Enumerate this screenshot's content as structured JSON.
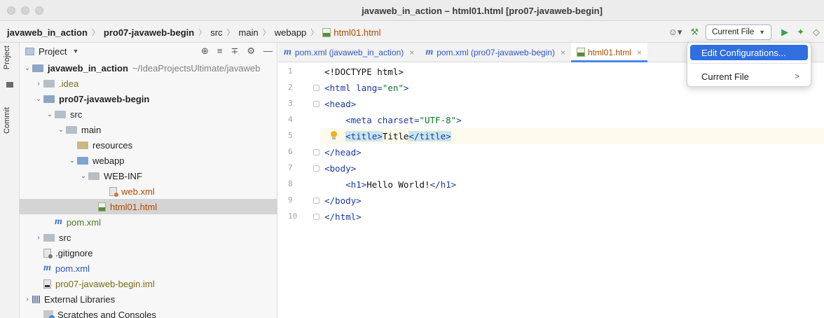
{
  "window": {
    "title": "javaweb_in_action – html01.html [pro07-javaweb-begin]"
  },
  "breadcrumb": [
    "javaweb_in_action",
    "pro07-javaweb-begin",
    "src",
    "main",
    "webapp",
    "html01.html"
  ],
  "toolbar": {
    "user_icon": "☺▾",
    "build_icon": "⚒",
    "run_config": "Current File",
    "run_icon": "▶",
    "debug_icon": "✦",
    "coverage_icon": "◇"
  },
  "stripe": {
    "project_tab": "Project",
    "commit_tab": "Commit"
  },
  "project_panel": {
    "title": "Project",
    "tools": [
      "⊕",
      "≡",
      "∓",
      "⚙",
      "—"
    ],
    "tree": [
      {
        "label": "javaweb_in_action",
        "path": "~/IdeaProjectsUltimate/javaweb"
      },
      {
        "label": ".idea"
      },
      {
        "label": "pro07-javaweb-begin"
      },
      {
        "label": "src"
      },
      {
        "label": "main"
      },
      {
        "label": "resources"
      },
      {
        "label": "webapp"
      },
      {
        "label": "WEB-INF"
      },
      {
        "label": "web.xml"
      },
      {
        "label": "html01.html"
      },
      {
        "label": "pom.xml"
      },
      {
        "label": "src"
      },
      {
        "label": ".gitignore"
      },
      {
        "label": "pom.xml"
      },
      {
        "label": "pro07-javaweb-begin.iml"
      },
      {
        "label": "External Libraries"
      },
      {
        "label": "Scratches and Consoles"
      }
    ]
  },
  "editor": {
    "tabs": [
      {
        "label": "pom.xml (javaweb_in_action)"
      },
      {
        "label": "pom.xml (pro07-javaweb-begin)"
      },
      {
        "label": "html01.html"
      }
    ],
    "line_numbers": [
      "1",
      "2",
      "3",
      "4",
      "5",
      "6",
      "7",
      "8",
      "9",
      "10"
    ],
    "lines": {
      "l1": "<!DOCTYPE html>",
      "l2_tag": "<html ",
      "l2_attr": "lang=",
      "l2_val": "\"en\"",
      "l2_end": ">",
      "l3": "<head>",
      "l4_tag": "<meta ",
      "l4_attr": "charset=",
      "l4_val": "\"UTF-8\"",
      "l4_end": ">",
      "l5_open": "<title>",
      "l5_text": "Title",
      "l5_close": "</title>",
      "l6": "</head>",
      "l7": "<body>",
      "l8_open": "<h1>",
      "l8_text": "Hello World!",
      "l8_close": "</h1>",
      "l9": "</body>",
      "l10": "</html>"
    }
  },
  "dropdown": {
    "items": [
      {
        "label": "Edit Configurations..."
      },
      {
        "label": "Current File",
        "chevron": ">"
      }
    ]
  }
}
